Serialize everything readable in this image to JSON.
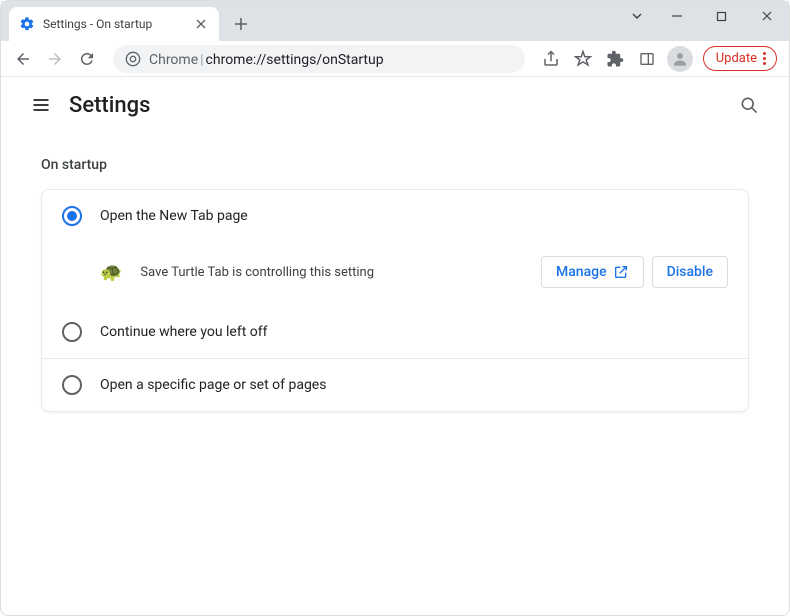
{
  "window": {
    "tab_title": "Settings - On startup"
  },
  "omnibox": {
    "prefix": "Chrome",
    "path": "chrome://settings/onStartup"
  },
  "update_button": "Update",
  "settings": {
    "title": "Settings",
    "section": "On startup",
    "options": [
      {
        "label": "Open the New Tab page"
      },
      {
        "label": "Continue where you left off"
      },
      {
        "label": "Open a specific page or set of pages"
      }
    ],
    "extension_notice": "Save Turtle Tab is controlling this setting",
    "extension_icon": "🐢",
    "manage_button": "Manage",
    "disable_button": "Disable"
  }
}
